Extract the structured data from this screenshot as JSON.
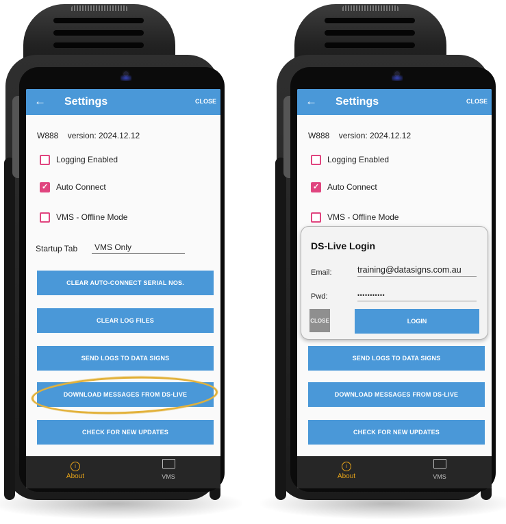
{
  "screens": [
    {
      "app_bar": {
        "back_glyph": "←",
        "title": "Settings",
        "close_label": "CLOSE"
      },
      "device": {
        "model": "W888",
        "version": "version: 2024.12.12"
      },
      "options": [
        {
          "label": "Logging Enabled",
          "checked": false
        },
        {
          "label": "Auto Connect",
          "checked": true
        },
        {
          "label": "VMS - Offline Mode",
          "checked": false
        }
      ],
      "startup_tab": {
        "label": "Startup Tab",
        "value": "VMS Only"
      },
      "buttons": [
        "CLEAR AUTO-CONNECT SERIAL NOS.",
        "CLEAR LOG FILES",
        "SEND LOGS TO DATA SIGNS",
        "DOWNLOAD MESSAGES FROM DS-LIVE",
        "CHECK FOR NEW UPDATES"
      ],
      "nav": {
        "about_label": "About",
        "vms_label": "VMS",
        "about_icon": "info-icon",
        "vms_icon": "monitor-icon"
      }
    },
    {
      "app_bar": {
        "back_glyph": "←",
        "title": "Settings",
        "close_label": "CLOSE"
      },
      "device": {
        "model": "W888",
        "version": "version: 2024.12.12"
      },
      "options": [
        {
          "label": "Logging Enabled",
          "checked": false
        },
        {
          "label": "Auto Connect",
          "checked": true
        },
        {
          "label": "VMS - Offline Mode",
          "checked": false
        }
      ],
      "buttons": [
        "SEND LOGS TO DATA SIGNS",
        "DOWNLOAD MESSAGES FROM DS-LIVE",
        "CHECK FOR NEW UPDATES"
      ],
      "dialog": {
        "title": "DS-Live Login",
        "email_label": "Email:",
        "email_value": "training@datasigns.com.au",
        "pwd_label": "Pwd:",
        "pwd_value": "•••••••••••",
        "close_label": "CLOSE",
        "login_label": "LOGIN"
      },
      "nav": {
        "about_label": "About",
        "vms_label": "VMS",
        "about_icon": "info-icon",
        "vms_icon": "monitor-icon"
      }
    }
  ],
  "colors": {
    "app_bar": "#4a98d8",
    "checkbox": "#e0457f",
    "highlight": "#e2b13a",
    "nav_active": "#e7a419",
    "nav_bg": "#262626"
  }
}
